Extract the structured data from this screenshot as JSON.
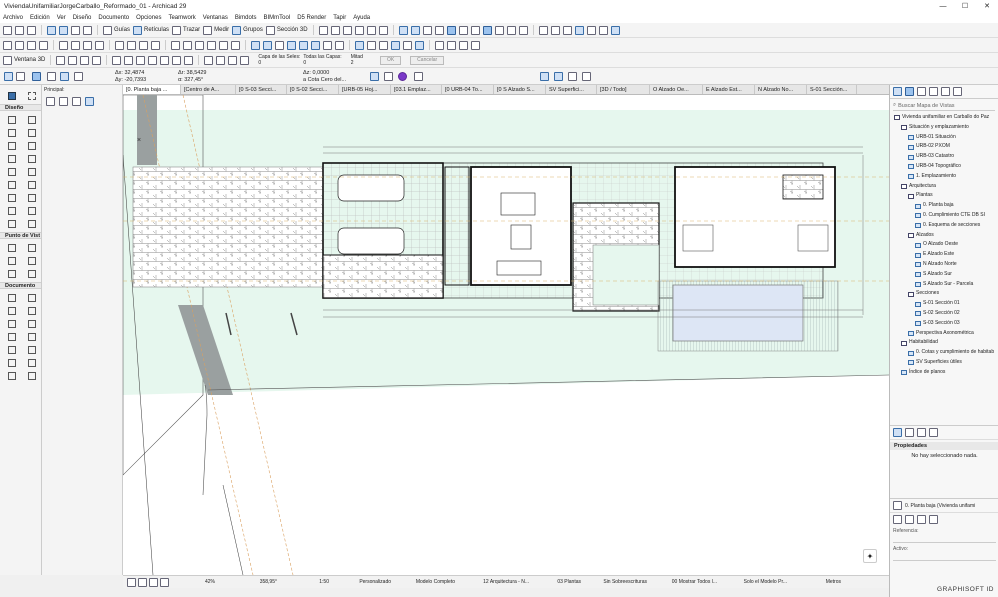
{
  "window": {
    "title": "ViviendaUnifamiliarJorgeCarballo_Reformado_01 - Archicad 29",
    "controls": [
      "—",
      "☐",
      "✕"
    ]
  },
  "menu": [
    "Archivo",
    "Edición",
    "Ver",
    "Diseño",
    "Documento",
    "Opciones",
    "Teamwork",
    "Ventanas",
    "Bimdots",
    "BIMmTool",
    "D5 Render",
    "Tapir",
    "Ayuda"
  ],
  "toolbar": {
    "guias": "Guías",
    "reticulas": "Retículas",
    "trazar": "Trazar",
    "medir": "Medir",
    "grupos": "Grupos",
    "seccion3d": "Sección 3D",
    "ventana3d": "Ventana 3D",
    "capa_selec": "Capa de las Seles:",
    "todas_capas": "Todas las Capas:",
    "capa_values": [
      "0",
      "0"
    ],
    "mitad": "Mitad",
    "mitad_val": "2",
    "ok": "OK",
    "cancelar": "Cancelar"
  },
  "infobox": {
    "ax": "Δx: 32,4874",
    "ay": "Δy: -20,7393",
    "ar": "Δr: 38,5429",
    "aa": "α: 327,45°",
    "az": "Δz: 0,0000",
    "cota": "a Cota Cero del...",
    "principal": "Principal:"
  },
  "tabs": [
    "[0. Planta baja ...",
    "[Centro de A...",
    "[0 S-03 Secci...",
    "[0 S-02 Secci...",
    "[URB-05 Hoj...",
    "[03.1 Emplaz...",
    "[0 URB-04 To...",
    "[0 S Alzado S...",
    "SV Superfici...",
    "[3D / Todo]",
    "O Alzado Oe...",
    "E Alzado Est...",
    "N Alzado No...",
    "S-01 Sección..."
  ],
  "toolbox": {
    "diseno": "Diseño",
    "punto_vista": "Punto de Vist",
    "documento": "Documento"
  },
  "navigator": {
    "search_placeholder": "Buscar Mapa de Vistas",
    "tree": [
      {
        "t": "Vivienda unifamiliar en Carballo do Paz",
        "lvl": 0,
        "k": "fold"
      },
      {
        "t": "Situación y emplazamiento",
        "lvl": 1,
        "k": "fold"
      },
      {
        "t": "URB-01 Situación",
        "lvl": 2,
        "k": "vw"
      },
      {
        "t": "URB-02 PXOM",
        "lvl": 2,
        "k": "vw"
      },
      {
        "t": "URB-03 Catastro",
        "lvl": 2,
        "k": "vw"
      },
      {
        "t": "URB-04 Topográfico",
        "lvl": 2,
        "k": "vw"
      },
      {
        "t": "1. Emplazamiento",
        "lvl": 2,
        "k": "vw"
      },
      {
        "t": "Arquitectura",
        "lvl": 1,
        "k": "fold"
      },
      {
        "t": "Plantas",
        "lvl": 2,
        "k": "fold"
      },
      {
        "t": "0. Planta baja",
        "lvl": 3,
        "k": "vw"
      },
      {
        "t": "0. Cumplimiento CTE DB SI",
        "lvl": 3,
        "k": "vw"
      },
      {
        "t": "0. Esquema de secciones",
        "lvl": 3,
        "k": "vw"
      },
      {
        "t": "Alzados",
        "lvl": 2,
        "k": "fold"
      },
      {
        "t": "O Alzado Oeste",
        "lvl": 3,
        "k": "vw"
      },
      {
        "t": "E Alzado Este",
        "lvl": 3,
        "k": "vw"
      },
      {
        "t": "N Alzado Norte",
        "lvl": 3,
        "k": "vw"
      },
      {
        "t": "S Alzado Sur",
        "lvl": 3,
        "k": "vw"
      },
      {
        "t": "S Alzado Sur - Parcela",
        "lvl": 3,
        "k": "vw"
      },
      {
        "t": "Secciones",
        "lvl": 2,
        "k": "fold"
      },
      {
        "t": "S-01 Sección 01",
        "lvl": 3,
        "k": "vw"
      },
      {
        "t": "S-02 Sección 02",
        "lvl": 3,
        "k": "vw"
      },
      {
        "t": "S-03 Sección 03",
        "lvl": 3,
        "k": "vw"
      },
      {
        "t": "Perspectiva Axonométrica",
        "lvl": 2,
        "k": "vw"
      },
      {
        "t": "Habitabilidad",
        "lvl": 1,
        "k": "fold"
      },
      {
        "t": "0. Cotas y cumplimiento de habitab",
        "lvl": 2,
        "k": "vw"
      },
      {
        "t": "SV Superficies útiles",
        "lvl": 2,
        "k": "vw"
      },
      {
        "t": "Índice de planos",
        "lvl": 1,
        "k": "vw"
      }
    ],
    "propiedades": "Propiedades",
    "no_sel": "No hay seleccionado nada.",
    "view_ref": "0. Planta baja (Vivienda unifami",
    "referencia": "Referencia:",
    "activo": "Activo:"
  },
  "status": {
    "zoom": "42%",
    "angle": "358,95°",
    "scale": "1:50",
    "custom": "Personalizado",
    "modelo": "Modelo Completo",
    "arq": "12 Arquitectura - N...",
    "plantas": "03 Plantas",
    "sobre": "Sin Sobreescrituras",
    "mostrar": "00 Mostrar Todos l...",
    "solo": "Solo el Modelo Pr...",
    "metros": "Metros"
  },
  "brand": "GRAPHISOFT ID",
  "colors": {
    "site": "#e6f7ee",
    "stone": "#9aa0a0",
    "accent": "#3a6ea8",
    "dims": "#d9b26a"
  }
}
